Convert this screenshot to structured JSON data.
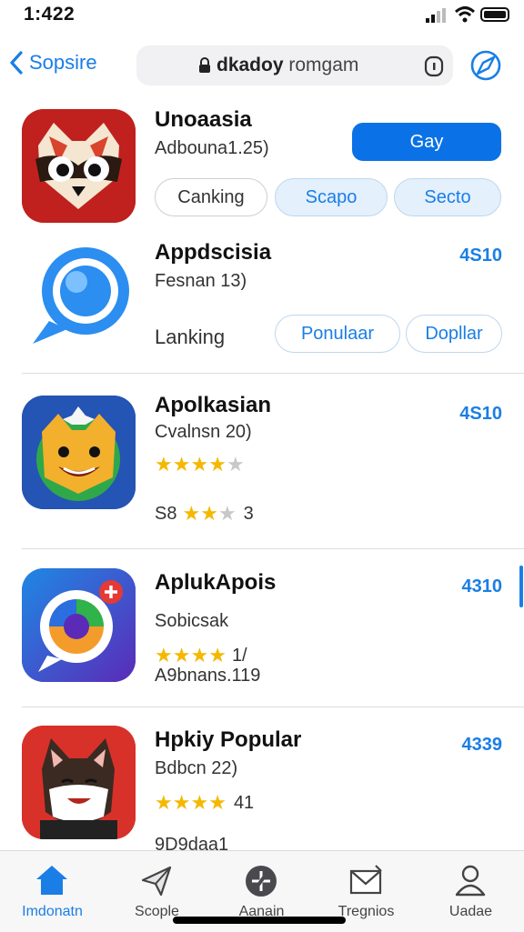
{
  "status": {
    "time": "1:422"
  },
  "nav": {
    "back_label": "Sopsire",
    "url_domain": "dkadoy",
    "url_rest": "romgam"
  },
  "apps": [
    {
      "name": "Unoaasia",
      "subtitle": "Adbouna1.25)",
      "action": "Gay",
      "chips": [
        "Canking",
        "Scapo",
        "Secto"
      ]
    },
    {
      "name": "Appdscisia",
      "subtitle": "Fesnan 13)",
      "price": "4S10",
      "label": "Lanking",
      "chips": [
        "Ponulaar",
        "Dopllar"
      ]
    },
    {
      "name": "Apolkasian",
      "subtitle": "Cvalnsn 20)",
      "price": "4S10",
      "rating_prefix": "S8",
      "rating_suffix": "3"
    },
    {
      "name": "AplukApois",
      "subtitle": "Sobicsak",
      "price": "4310",
      "rating_suffix": "1/",
      "extra": "A9bnans.119"
    },
    {
      "name": "Hpkiy Popular",
      "subtitle": "Bdbcn 22)",
      "price": "4339",
      "rating_suffix": "41",
      "extra": "9D9daa1"
    }
  ],
  "tabs": [
    {
      "label": "Imdonatn",
      "icon": "home-icon"
    },
    {
      "label": "Scople",
      "icon": "paper-plane-icon"
    },
    {
      "label": "Aanain",
      "icon": "compass-icon"
    },
    {
      "label": "Tregnios",
      "icon": "envelope-icon"
    },
    {
      "label": "Uadae",
      "icon": "person-icon"
    }
  ],
  "colors": {
    "accent": "#1a7ee6",
    "button": "#0a72e6",
    "star": "#f5b800"
  }
}
